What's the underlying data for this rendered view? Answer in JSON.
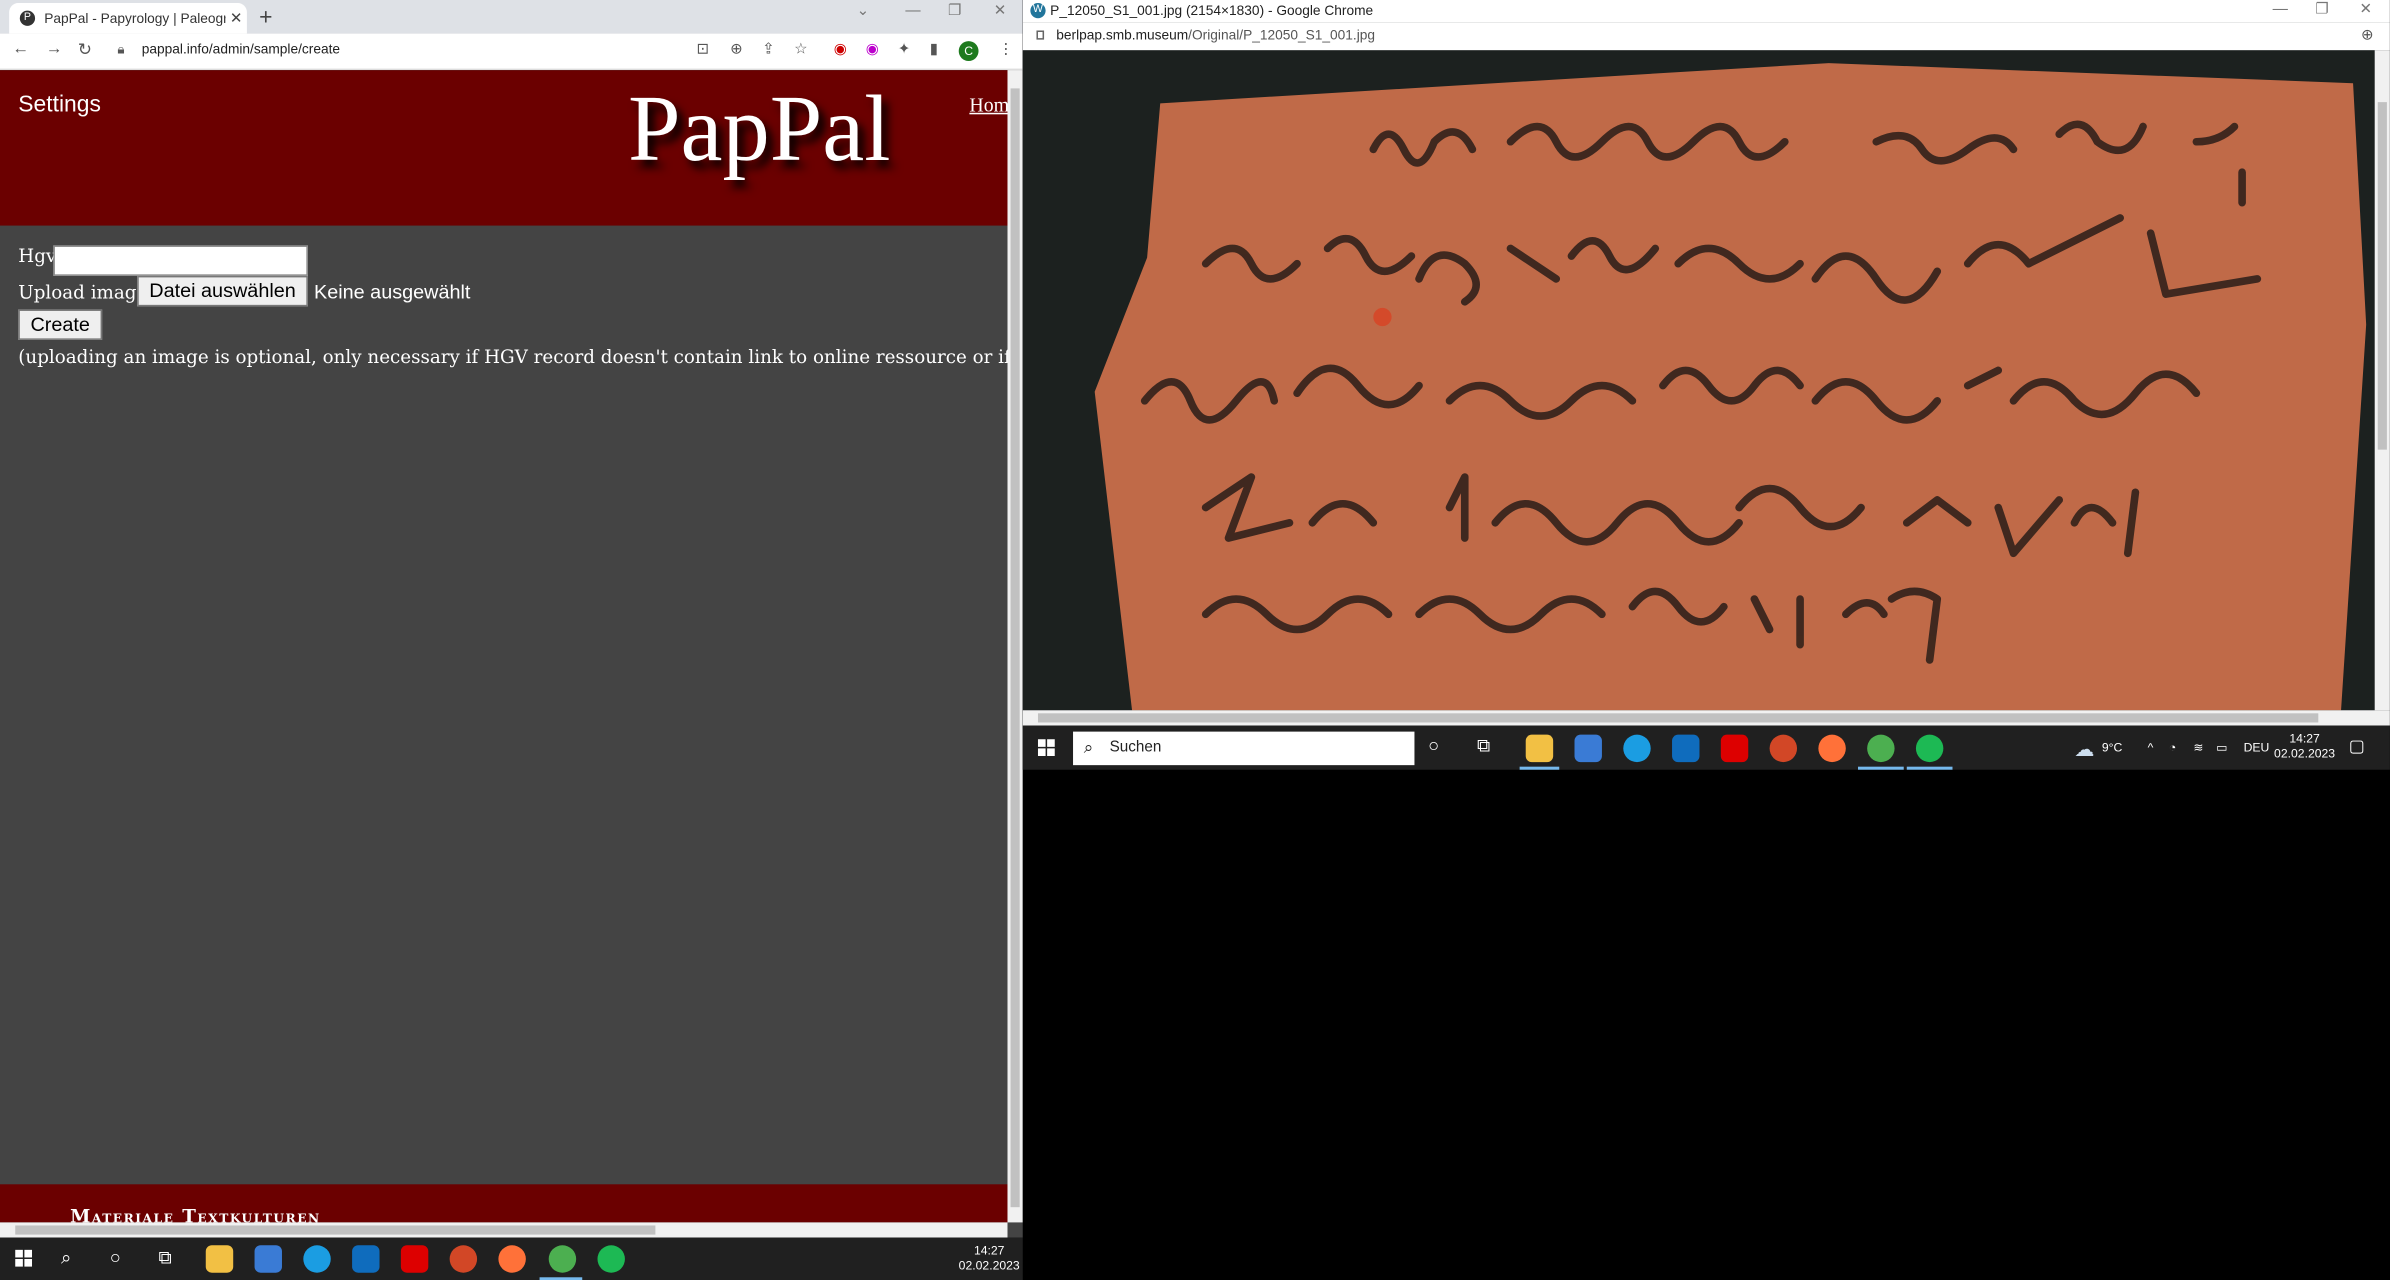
{
  "left_browser": {
    "tab_title": "PapPal - Papyrology | Paleograph",
    "tab_favicon_letter": "P",
    "new_tab": "+",
    "url": "pappal.info/admin/sample/create",
    "profile_letter": "C",
    "header": {
      "settings": "Settings",
      "logo": "PapPal",
      "home_link": "Home"
    },
    "form": {
      "hgv_label": "Hgv",
      "upload_label": "Upload image",
      "file_button": "Datei auswählen",
      "no_file": "Keine ausgewählt",
      "create_button": "Create",
      "note": "(uploading an image is optional, only necessary if HGV record doesn't contain link to online ressource or if online arc"
    },
    "footer_text": "Materiale Textkulturen"
  },
  "right_browser": {
    "window_title": "P_12050_S1_001.jpg (2154×1830) - Google Chrome",
    "url_host": "berlpap.smb.museum",
    "url_path": "/Original/P_12050_S1_001.jpg"
  },
  "taskbar_left": {
    "time": "14:27",
    "date": "02.02.2023"
  },
  "taskbar_right": {
    "search_placeholder": "Suchen",
    "temperature": "9°C",
    "language": "DEU",
    "time": "14:27",
    "date": "02.02.2023"
  },
  "colors": {
    "header_red": "#6b0000",
    "page_bg": "#444444",
    "shard": "#c06a48"
  }
}
